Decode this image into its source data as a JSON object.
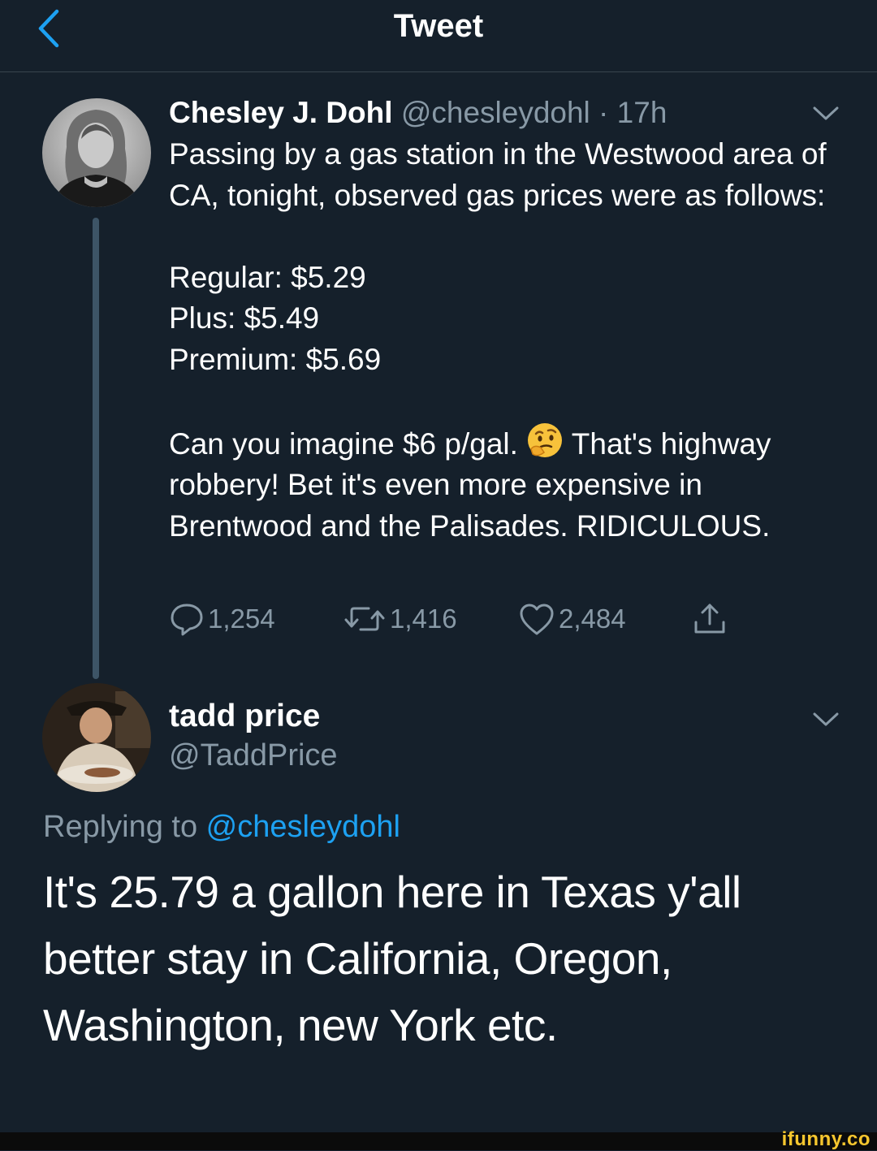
{
  "header": {
    "title": "Tweet",
    "back_icon": "chevron-left-icon"
  },
  "tweet": {
    "name": "Chesley J. Dohl",
    "handle": "@chesleydohl",
    "separator": " · ",
    "time": "17h",
    "body": {
      "intro": "Passing by a gas station in the Westwood area of CA, tonight, observed gas prices were as follows:",
      "prices": [
        "Regular: $5.29",
        "Plus: $5.49",
        "Premium: $5.69"
      ],
      "closing_before_emoji": "Can you imagine $6 p/gal.",
      "emoji": "thinking-face",
      "closing_after_emoji": "That's highway robbery! Bet it's even more expensive in Brentwood and the Palisades. RIDICULOUS."
    },
    "stats": {
      "replies": "1,254",
      "retweets": "1,416",
      "likes": "2,484"
    }
  },
  "reply": {
    "name": "tadd price",
    "handle": "@TaddPrice",
    "replying_label": "Replying to ",
    "replying_to": "@chesleydohl",
    "body": "It's 25.79 a gallon here in Texas y'all better stay in California, Oregon, Washington, new York etc."
  },
  "watermark": "ifunny.co",
  "colors": {
    "background": "#15202b",
    "text": "#ffffff",
    "muted": "#8899a6",
    "accent": "#1da1f2",
    "divider": "#38444d"
  }
}
